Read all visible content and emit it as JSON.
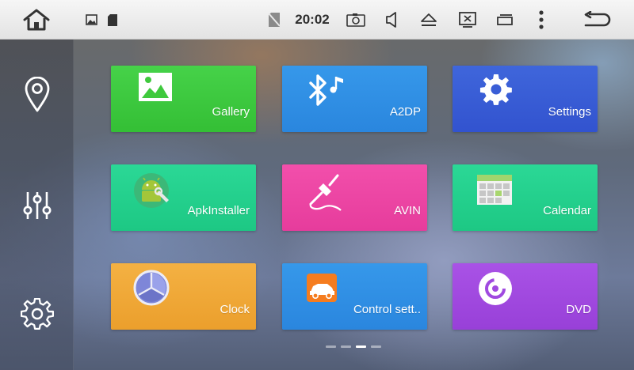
{
  "status_bar": {
    "time": "20:02",
    "icons": [
      "home-icon",
      "gallery-notif-icon",
      "sd-card-icon",
      "no-sim-icon",
      "camera-icon",
      "volume-icon",
      "eject-icon",
      "screen-off-icon",
      "window-icon",
      "more-icon",
      "back-icon"
    ]
  },
  "sidebar": {
    "items": [
      {
        "name": "navigation",
        "icon": "location-pin-icon"
      },
      {
        "name": "equalizer",
        "icon": "sliders-icon"
      },
      {
        "name": "settings",
        "icon": "gear-icon"
      }
    ]
  },
  "apps": [
    {
      "label": "Gallery",
      "icon": "image-icon",
      "color": "#3fc93d"
    },
    {
      "label": "A2DP",
      "icon": "bluetooth-music-icon",
      "color": "#2f8fe3"
    },
    {
      "label": "Settings",
      "icon": "gear-icon",
      "color": "#3a5ed6"
    },
    {
      "label": "ApkInstaller",
      "icon": "android-icon",
      "color": "#22d18d"
    },
    {
      "label": "AVIN",
      "icon": "av-cable-icon",
      "color": "#ef46a6"
    },
    {
      "label": "Calendar",
      "icon": "calendar-icon",
      "color": "#22d18d"
    },
    {
      "label": "Clock",
      "icon": "clock-icon",
      "color": "#f0a636"
    },
    {
      "label": "Control sett..",
      "icon": "car-icon",
      "color": "#2f8fe3"
    },
    {
      "label": "DVD",
      "icon": "disc-icon",
      "color": "#a04ae0"
    }
  ],
  "pager": {
    "pages": 4,
    "current": 3
  }
}
